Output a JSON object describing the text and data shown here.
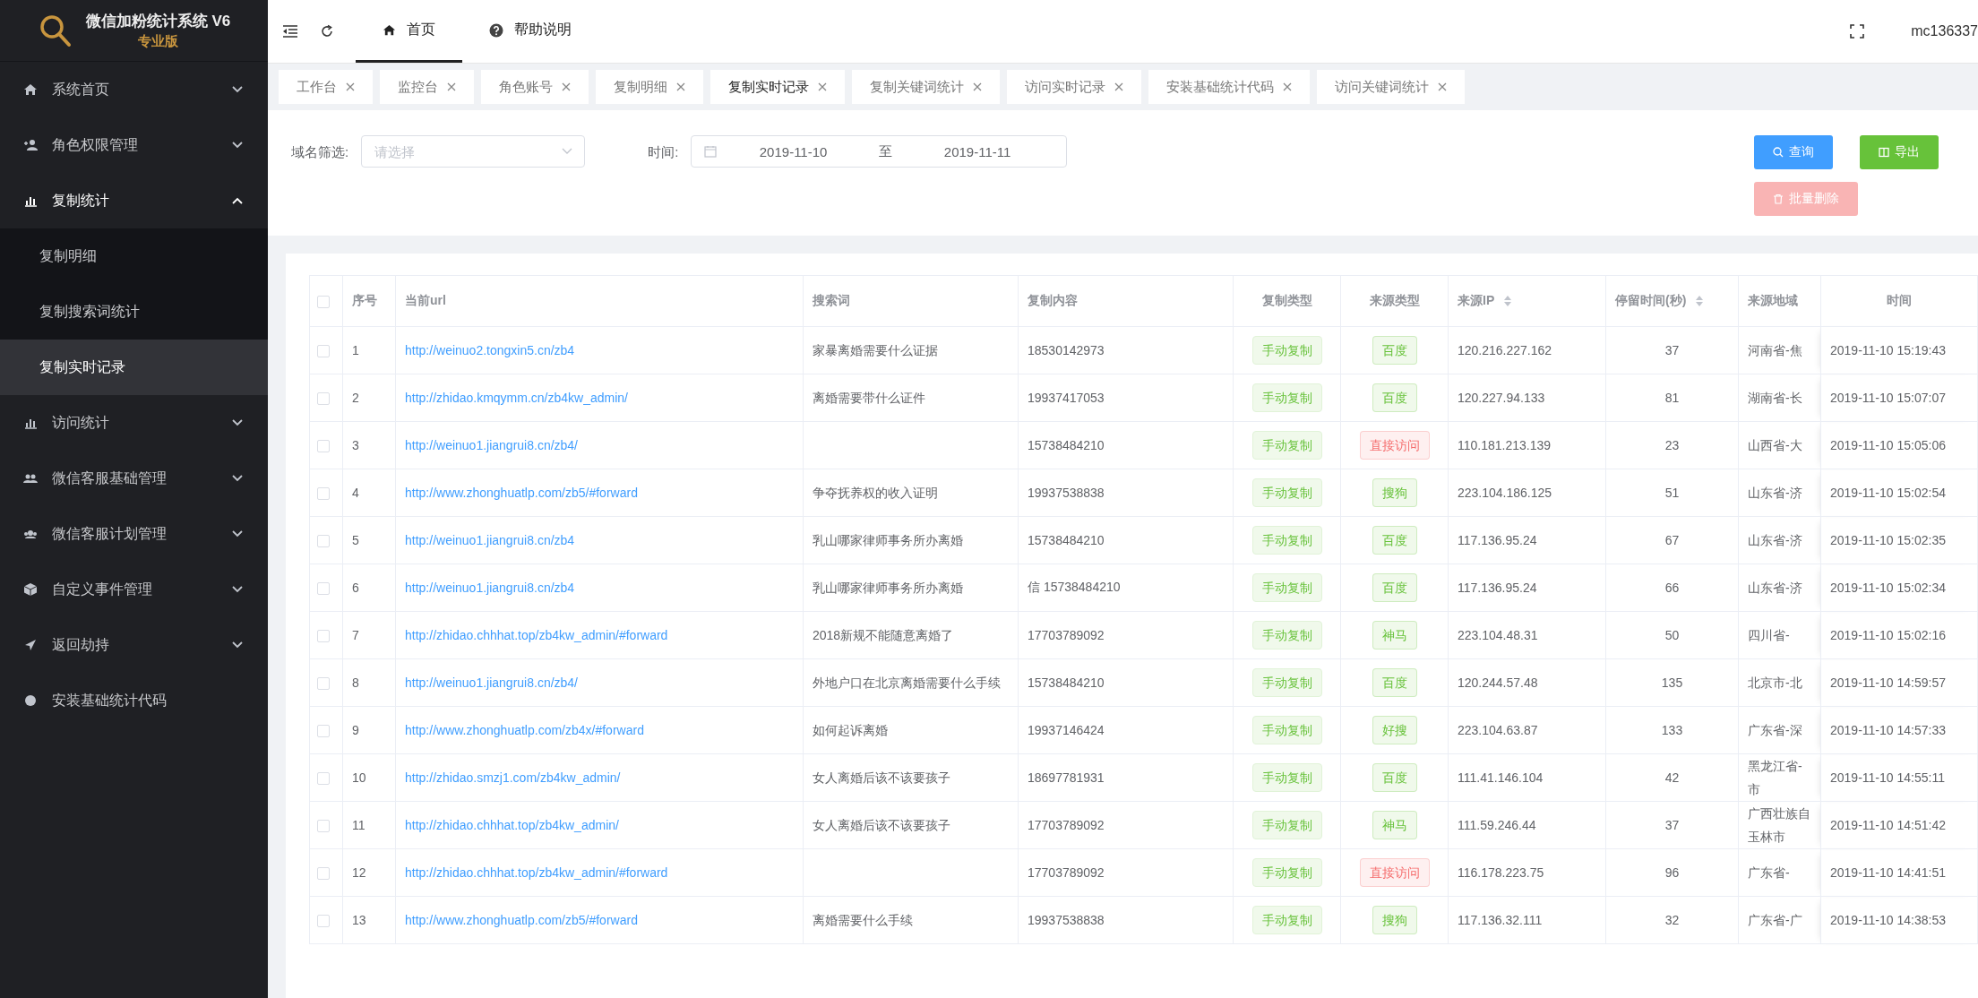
{
  "logo": {
    "title": "微信加粉统计系统 V6",
    "subtitle": "专业版"
  },
  "sidebar": {
    "items": [
      {
        "label": "系统首页",
        "expanded": false
      },
      {
        "label": "角色权限管理",
        "expanded": false
      },
      {
        "label": "复制统计",
        "expanded": true,
        "children": [
          {
            "label": "复制明细",
            "selected": false
          },
          {
            "label": "复制搜索词统计",
            "selected": false
          },
          {
            "label": "复制实时记录",
            "selected": true
          }
        ]
      },
      {
        "label": "访问统计",
        "expanded": false
      },
      {
        "label": "微信客服基础管理",
        "expanded": false
      },
      {
        "label": "微信客服计划管理",
        "expanded": false
      },
      {
        "label": "自定义事件管理",
        "expanded": false
      },
      {
        "label": "返回劫持",
        "expanded": false
      },
      {
        "label": "安装基础统计代码"
      }
    ]
  },
  "topbar": {
    "nav": [
      {
        "label": "首页",
        "selected": true
      },
      {
        "label": "帮助说明",
        "selected": false
      }
    ],
    "user": "mc136337"
  },
  "tabs": [
    {
      "label": "工作台",
      "selected": false
    },
    {
      "label": "监控台",
      "selected": false
    },
    {
      "label": "角色账号",
      "selected": false
    },
    {
      "label": "复制明细",
      "selected": false
    },
    {
      "label": "复制实时记录",
      "selected": true
    },
    {
      "label": "复制关键词统计",
      "selected": false
    },
    {
      "label": "访问实时记录",
      "selected": false
    },
    {
      "label": "安装基础统计代码",
      "selected": false
    },
    {
      "label": "访问关键词统计",
      "selected": false
    }
  ],
  "filter": {
    "domain_label": "域名筛选:",
    "domain_placeholder": "请选择",
    "time_label": "时间:",
    "start": "2019-11-10",
    "separator": "至",
    "end": "2019-11-11"
  },
  "buttons": [
    {
      "label": "查询",
      "kind": "query",
      "disabled": false
    },
    {
      "label": "导出",
      "kind": "export",
      "disabled": false
    },
    {
      "label": "批量删除",
      "kind": "delete",
      "disabled": true
    }
  ],
  "table": {
    "all_checked": false,
    "columns": [
      {
        "label": "序号"
      },
      {
        "label": "当前url"
      },
      {
        "label": "搜索词"
      },
      {
        "label": "复制内容"
      },
      {
        "label": "复制类型"
      },
      {
        "label": "来源类型"
      },
      {
        "label": "来源IP",
        "sortable": true
      },
      {
        "label": "停留时间(秒)",
        "sortable": true
      },
      {
        "label": "来源地域"
      },
      {
        "label": "时间"
      }
    ],
    "rows": [
      {
        "checked": false,
        "no": "1",
        "url": "http://weinuo2.tongxin5.cn/zb4",
        "keyword": "家暴离婚需要什么证据",
        "content": "18530142973",
        "copy_type": "手动复制",
        "source": {
          "label": "百度",
          "color": "#67c23a"
        },
        "ip": "120.216.227.162",
        "stay": "37",
        "region": [
          "河南省-焦"
        ],
        "time": "2019-11-10 15:19:43"
      },
      {
        "checked": false,
        "no": "2",
        "url": "http://zhidao.kmqymm.cn/zb4kw_admin/",
        "keyword": "离婚需要带什么证件",
        "content": "19937417053",
        "copy_type": "手动复制",
        "source": {
          "label": "百度",
          "color": "#67c23a"
        },
        "ip": "120.227.94.133",
        "stay": "81",
        "region": [
          "湖南省-长"
        ],
        "time": "2019-11-10 15:07:07"
      },
      {
        "checked": false,
        "no": "3",
        "url": "http://weinuo1.jiangrui8.cn/zb4/",
        "content": "15738484210",
        "copy_type": "手动复制",
        "source": {
          "label": "直接访问",
          "color": "#f56c6c"
        },
        "ip": "110.181.213.139",
        "stay": "23",
        "region": [
          "山西省-大"
        ],
        "time": "2019-11-10 15:05:06"
      },
      {
        "checked": false,
        "no": "4",
        "url": "http://www.zhonghuatlp.com/zb5/#forward",
        "keyword": "争夺抚养权的收入证明",
        "content": "19937538838",
        "copy_type": "手动复制",
        "source": {
          "label": "搜狗",
          "color": "#67c23a"
        },
        "ip": "223.104.186.125",
        "stay": "51",
        "region": [
          "山东省-济"
        ],
        "time": "2019-11-10 15:02:54"
      },
      {
        "checked": false,
        "no": "5",
        "url": "http://weinuo1.jiangrui8.cn/zb4",
        "keyword": "乳山哪家律师事务所办离婚",
        "content": "15738484210",
        "copy_type": "手动复制",
        "source": {
          "label": "百度",
          "color": "#67c23a"
        },
        "ip": "117.136.95.24",
        "stay": "67",
        "region": [
          "山东省-济"
        ],
        "time": "2019-11-10 15:02:35"
      },
      {
        "checked": false,
        "no": "6",
        "url": "http://weinuo1.jiangrui8.cn/zb4",
        "keyword": "乳山哪家律师事务所办离婚",
        "content": "信 15738484210",
        "copy_type": "手动复制",
        "source": {
          "label": "百度",
          "color": "#67c23a"
        },
        "ip": "117.136.95.24",
        "stay": "66",
        "region": [
          "山东省-济"
        ],
        "time": "2019-11-10 15:02:34"
      },
      {
        "checked": false,
        "no": "7",
        "url": "http://zhidao.chhhat.top/zb4kw_admin/#forward",
        "keyword": "2018新规不能随意离婚了",
        "content": "17703789092",
        "copy_type": "手动复制",
        "source": {
          "label": "神马",
          "color": "#67c23a"
        },
        "ip": "223.104.48.31",
        "stay": "50",
        "region": [
          "四川省-"
        ],
        "time": "2019-11-10 15:02:16"
      },
      {
        "checked": false,
        "no": "8",
        "url": "http://weinuo1.jiangrui8.cn/zb4/",
        "keyword": "外地户口在北京离婚需要什么手续",
        "content": "15738484210",
        "copy_type": "手动复制",
        "source": {
          "label": "百度",
          "color": "#67c23a"
        },
        "ip": "120.244.57.48",
        "stay": "135",
        "region": [
          "北京市-北"
        ],
        "time": "2019-11-10 14:59:57"
      },
      {
        "checked": false,
        "no": "9",
        "url": "http://www.zhonghuatlp.com/zb4x/#forward",
        "keyword": "如何起诉离婚",
        "content": "19937146424",
        "copy_type": "手动复制",
        "source": {
          "label": "好搜",
          "color": "#67c23a"
        },
        "ip": "223.104.63.87",
        "stay": "133",
        "region": [
          "广东省-深"
        ],
        "time": "2019-11-10 14:57:33"
      },
      {
        "checked": false,
        "no": "10",
        "url": "http://zhidao.smzj1.com/zb4kw_admin/",
        "keyword": "女人离婚后该不该要孩子",
        "content": "18697781931",
        "copy_type": "手动复制",
        "source": {
          "label": "百度",
          "color": "#67c23a"
        },
        "ip": "111.41.146.104",
        "stay": "42",
        "region": [
          "黑龙江省-",
          "市"
        ],
        "time": "2019-11-10 14:55:11"
      },
      {
        "checked": false,
        "no": "11",
        "url": "http://zhidao.chhhat.top/zb4kw_admin/",
        "keyword": "女人离婚后该不该要孩子",
        "content": "17703789092",
        "copy_type": "手动复制",
        "source": {
          "label": "神马",
          "color": "#67c23a"
        },
        "ip": "111.59.246.44",
        "stay": "37",
        "region": [
          "广西壮族自",
          "玉林市"
        ],
        "time": "2019-11-10 14:51:42"
      },
      {
        "checked": false,
        "no": "12",
        "url": "http://zhidao.chhhat.top/zb4kw_admin/#forward",
        "content": "17703789092",
        "copy_type": "手动复制",
        "source": {
          "label": "直接访问",
          "color": "#f56c6c"
        },
        "ip": "116.178.223.75",
        "stay": "96",
        "region": [
          "广东省-"
        ],
        "time": "2019-11-10 14:41:51"
      },
      {
        "checked": false,
        "no": "13",
        "url": "http://www.zhonghuatlp.com/zb5/#forward",
        "keyword": "离婚需要什么手续",
        "content": "19937538838",
        "copy_type": "手动复制",
        "source": {
          "label": "搜狗",
          "color": "#67c23a"
        },
        "ip": "117.136.32.111",
        "stay": "32",
        "region": [
          "广东省-广"
        ],
        "time": "2019-11-10 14:38:53"
      }
    ]
  }
}
